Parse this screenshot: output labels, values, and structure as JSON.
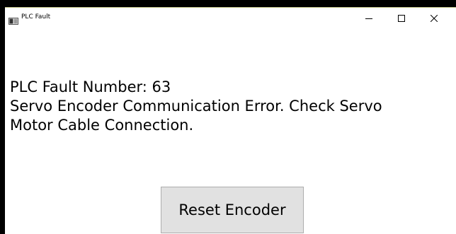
{
  "window": {
    "title": "PLC Fault",
    "controls": {
      "minimize_icon": "minimize-icon",
      "maximize_icon": "maximize-icon",
      "close_icon": "close-icon"
    }
  },
  "fault": {
    "number_line": "PLC Fault Number: 63",
    "message_line1": "Servo Encoder Communication Error. Check Servo",
    "message_line2": "Motor Cable Connection."
  },
  "actions": {
    "reset_label": "Reset Encoder"
  },
  "colors": {
    "background": "#ffffff",
    "button_face": "#e1e1e1",
    "button_border": "#adadad",
    "outside": "#000000"
  }
}
